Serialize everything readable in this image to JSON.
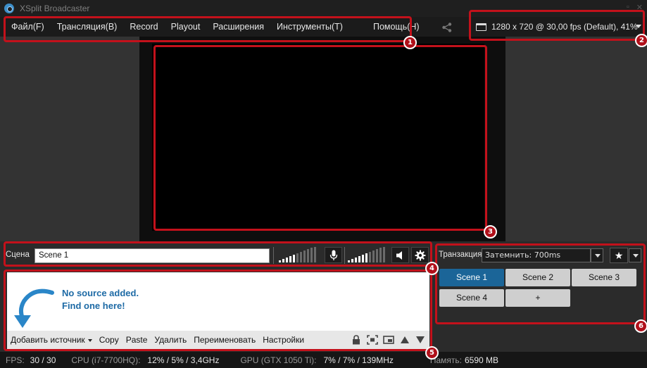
{
  "app": {
    "title": "XSplit Broadcaster"
  },
  "menu": {
    "items": [
      "Файл(F)",
      "Трансляция(B)",
      "Record",
      "Playout",
      "Расширения",
      "Инструменты(T)",
      "Помощь(H)"
    ]
  },
  "resolution": {
    "label": "1280 x 720 @ 30,00 fps (Default), 41%"
  },
  "scene": {
    "label": "Сцена",
    "value": "Scene 1"
  },
  "sources": {
    "empty_line1": "No source added.",
    "empty_line2": "Find one here!",
    "toolbar": {
      "add": "Добавить источник",
      "copy": "Copy",
      "paste": "Paste",
      "delete": "Удалить",
      "rename": "Переименовать",
      "settings": "Настройки"
    }
  },
  "transition": {
    "label": "Транзакция",
    "value": "Затемнить: 700ms"
  },
  "scenes": {
    "items": [
      "Scene 1",
      "Scene 2",
      "Scene 3",
      "Scene 4"
    ],
    "add_label": "+",
    "active_index": 0
  },
  "status": {
    "fps_label": "FPS:",
    "fps_value": "30 / 30",
    "cpu_label": "CPU (i7-7700HQ):",
    "cpu_value": "12% / 5% / 3,4GHz",
    "gpu_label": "GPU (GTX 1050 Ti):",
    "gpu_value": "7% / 7% / 139MHz",
    "mem_label": "Память:",
    "mem_value": "6590 MB"
  },
  "annotations": [
    "1",
    "2",
    "3",
    "4",
    "5",
    "6"
  ],
  "colors": {
    "highlight": "#c3111b",
    "active_scene": "#1b6598",
    "link_text": "#1d6aa5"
  }
}
